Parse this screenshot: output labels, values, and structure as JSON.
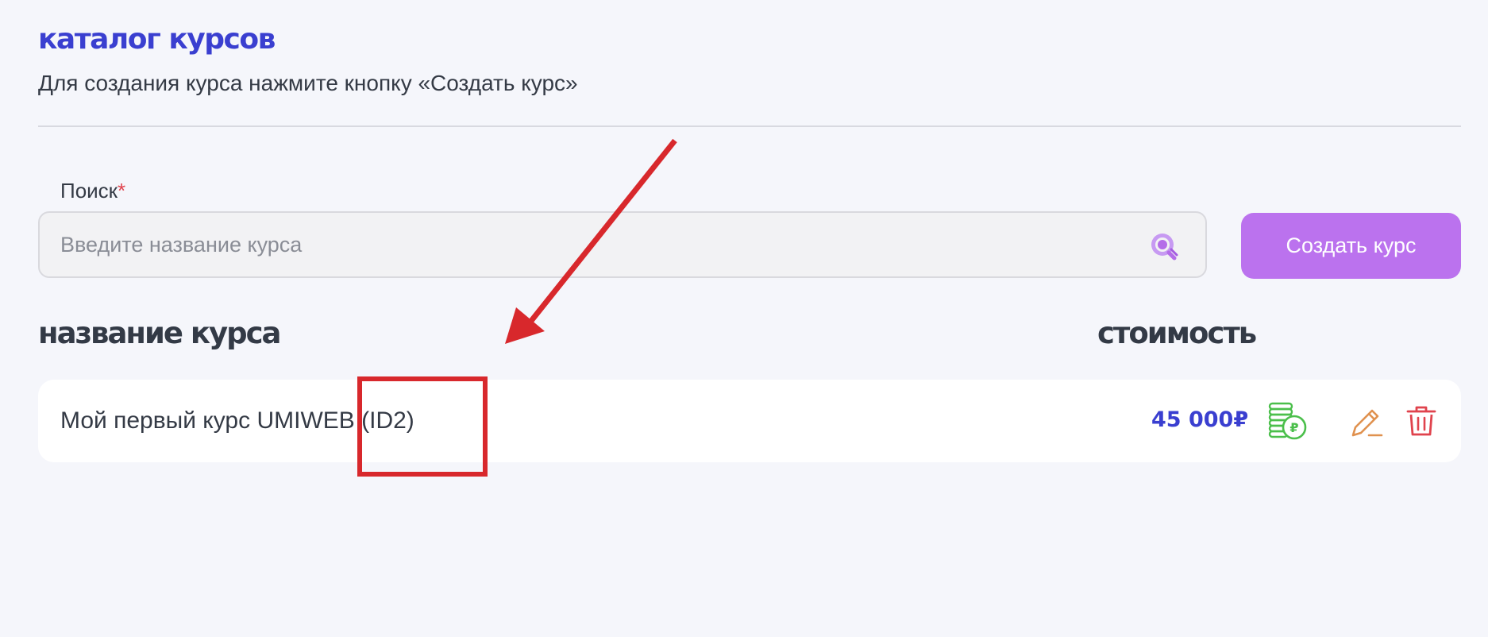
{
  "header": {
    "title": "каталог курсов",
    "subtitle": "Для создания курса нажмите кнопку «Создать курс»"
  },
  "search": {
    "label": "Поиск",
    "required_mark": "*",
    "placeholder": "Введите название курса",
    "value": "",
    "icon": "search-icon"
  },
  "toolbar": {
    "create_label": "Создать курс"
  },
  "table": {
    "columns": {
      "name": "название курса",
      "price": "стоимость"
    },
    "rows": [
      {
        "name": "Мой первый курс UMIWEB (ID2)",
        "price": "45 000₽",
        "icons": [
          "coins-ruble-icon",
          "edit-pencil-icon",
          "trash-icon"
        ]
      }
    ]
  },
  "colors": {
    "background": "#f5f6fb",
    "title_accent": "#3a3fd0",
    "create_button": "#bb72ee",
    "coins_icon": "#4bbf4b",
    "edit_icon": "#e0914f",
    "delete_icon": "#e0434d",
    "annotation": "#d8282c"
  }
}
